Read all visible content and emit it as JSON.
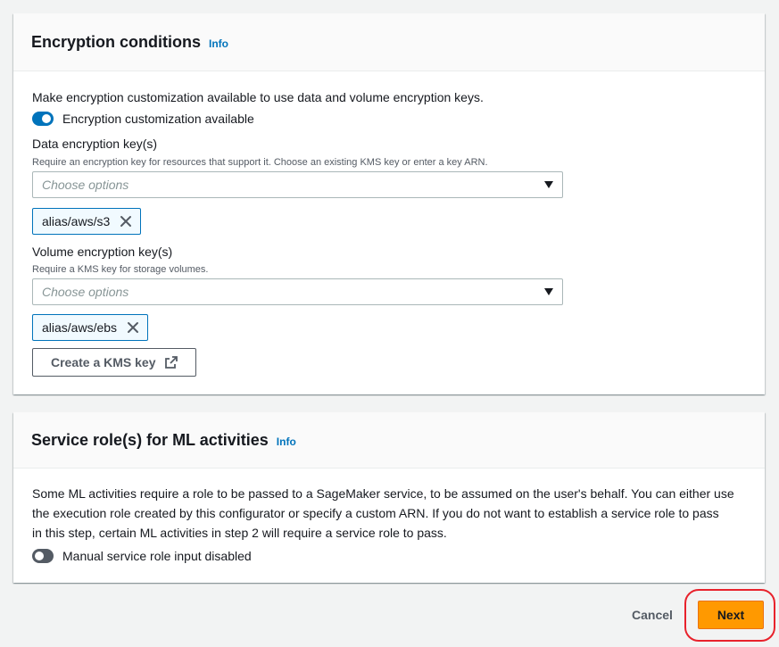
{
  "encryption": {
    "title": "Encryption conditions",
    "info": "Info",
    "description": "Make encryption customization available to use data and volume encryption keys.",
    "toggle_label": "Encryption customization available",
    "toggle_on": true,
    "data_key": {
      "label": "Data encryption key(s)",
      "description": "Require an encryption key for resources that support it. Choose an existing KMS key or enter a key ARN.",
      "placeholder": "Choose options",
      "tokens": [
        "alias/aws/s3"
      ]
    },
    "volume_key": {
      "label": "Volume encryption key(s)",
      "description": "Require a KMS key for storage volumes.",
      "placeholder": "Choose options",
      "tokens": [
        "alias/aws/ebs"
      ]
    },
    "create_kms_label": "Create a KMS key"
  },
  "service_role": {
    "title": "Service role(s) for ML activities",
    "info": "Info",
    "description_lines": [
      "Some ML activities require a role to be passed to a SageMaker service, to be assumed on the user's behalf. You can either use",
      "the execution role created by this configurator or specify a custom ARN. If you do not want to establish a service role to pass",
      "in this step, certain ML activities in step 2 will require a service role to pass."
    ],
    "toggle_label": "Manual service role input disabled",
    "toggle_on": false
  },
  "footer": {
    "cancel_label": "Cancel",
    "next_label": "Next"
  },
  "colors": {
    "primary_button": "#ff9900",
    "link": "#0073bb",
    "highlight": "#e8222c"
  }
}
